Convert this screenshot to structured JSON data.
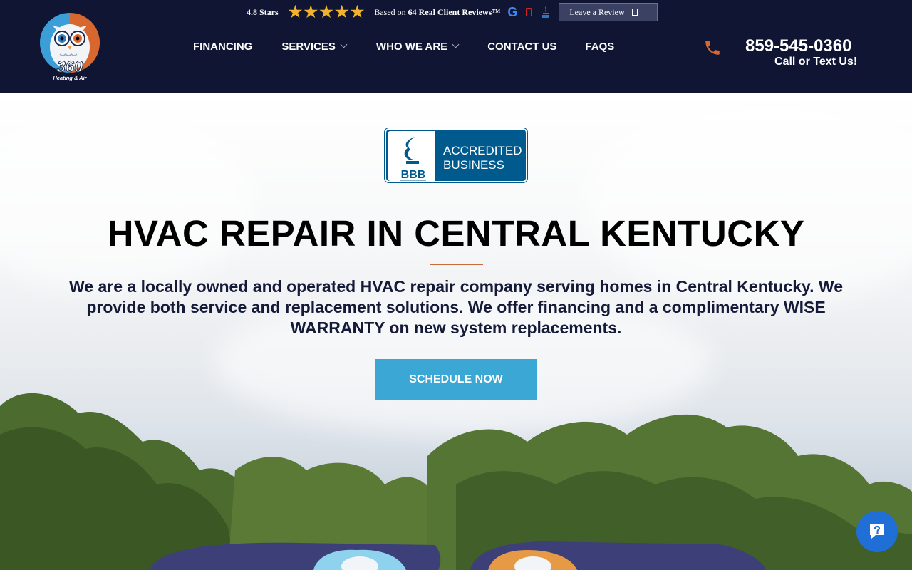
{
  "brand": {
    "logo_number": "360",
    "logo_tagline": "Heating & Air"
  },
  "reviews_bar": {
    "rating_label": "4.8 Stars",
    "star_count": 5,
    "based_prefix": "Based on",
    "review_count": "64",
    "based_suffix": "Real Client Reviews",
    "trademark": "™",
    "icons": [
      "google-icon",
      "yelp-icon",
      "bbb-icon"
    ],
    "leave_review_label": "Leave a Review"
  },
  "nav": {
    "items": [
      {
        "label": "FINANCING",
        "has_dropdown": false
      },
      {
        "label": "SERVICES",
        "has_dropdown": true
      },
      {
        "label": "WHO WE ARE",
        "has_dropdown": true
      },
      {
        "label": "CONTACT US",
        "has_dropdown": false
      },
      {
        "label": "FAQS",
        "has_dropdown": false
      }
    ]
  },
  "contact": {
    "phone": "859-545-0360",
    "phone_sub": "Call or Text Us!"
  },
  "hero": {
    "badge_line1": "ACCREDITED",
    "badge_line2": "BUSINESS",
    "badge_logo_text": "BBB",
    "title": "HVAC REPAIR IN CENTRAL KENTUCKY",
    "lead": "We are a locally owned and operated HVAC repair company serving homes in Central Kentucky. We provide both service and replacement solutions. We offer financing and a complimentary WISE WARRANTY on new system replacements.",
    "cta_label": "SCHEDULE NOW"
  },
  "colors": {
    "header_bg": "#0f1533",
    "accent_blue": "#3aa7d4",
    "accent_orange": "#c96a3a",
    "star": "#f1b32b",
    "chat": "#1f6fd6"
  }
}
